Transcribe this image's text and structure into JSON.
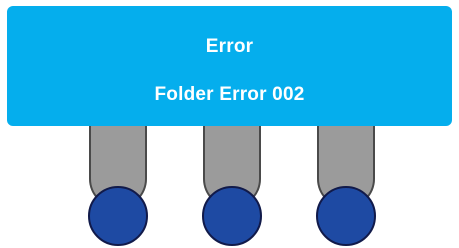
{
  "banner": {
    "title": "Error",
    "message": "Folder Error 002",
    "color": "#05aeed",
    "text_color": "#ffffff"
  },
  "indicators": {
    "mount_color": "#9b9b9b",
    "dot_color": "#1e4aa3",
    "items": [
      {
        "icon": "status-dot"
      },
      {
        "icon": "status-dot"
      },
      {
        "icon": "status-dot"
      }
    ]
  }
}
